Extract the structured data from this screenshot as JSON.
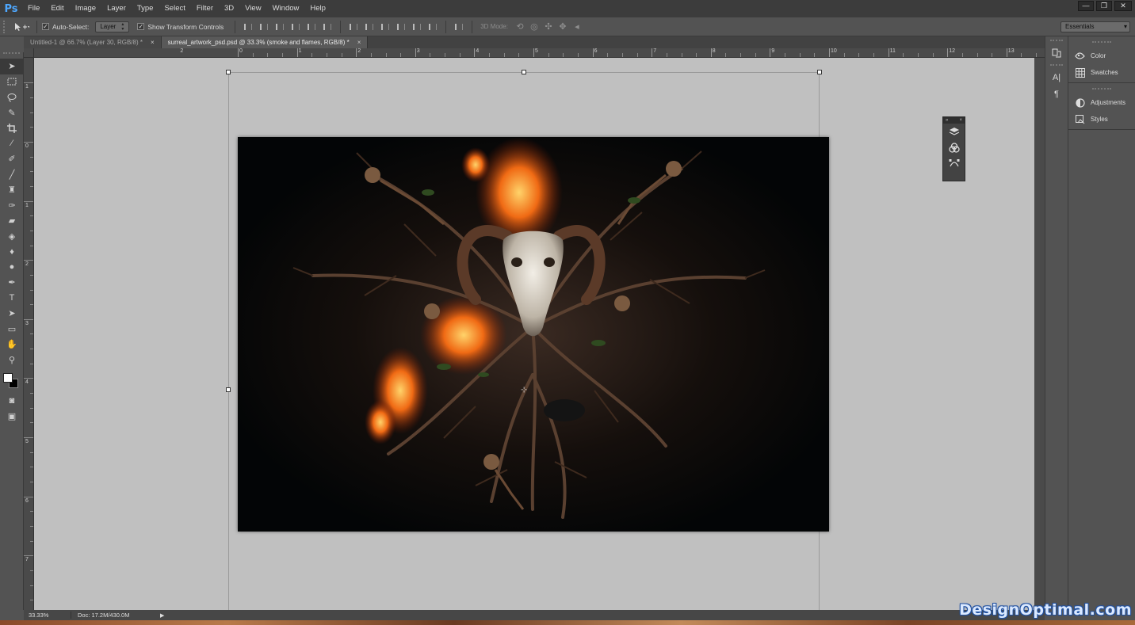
{
  "app": {
    "logo": "Ps"
  },
  "menu": [
    "File",
    "Edit",
    "Image",
    "Layer",
    "Type",
    "Select",
    "Filter",
    "3D",
    "View",
    "Window",
    "Help"
  ],
  "window_controls": {
    "minimize": "—",
    "restore": "❐",
    "close": "✕"
  },
  "options": {
    "auto_select_label": "Auto-Select:",
    "auto_select_checked": "✓",
    "auto_select_target": "Layer",
    "show_transform_label": "Show Transform Controls",
    "show_transform_checked": "✓",
    "mode_3d_label": "3D Mode:",
    "workspace": "Essentials"
  },
  "tabs": [
    {
      "label": "Untitled-1 @ 66.7% (Layer 30, RGB/8) *",
      "close": "×"
    },
    {
      "label": "surreal_artwork_psd.psd @ 33.3% (smoke and flames, RGB/8) *",
      "close": "×"
    }
  ],
  "ruler": {
    "h_labels": [
      "0",
      "1",
      "2",
      "3",
      "4",
      "5",
      "6",
      "7",
      "8",
      "9",
      "10",
      "11",
      "12",
      "13"
    ],
    "v_labels": [
      "1",
      "0",
      "1",
      "2",
      "3",
      "4",
      "5",
      "6",
      "7"
    ]
  },
  "panels": {
    "dock": [
      {
        "label": "Color",
        "icon": "color-wheel-icon"
      },
      {
        "label": "Swatches",
        "icon": "swatches-grid-icon"
      },
      {
        "label": "Adjustments",
        "icon": "adjustments-icon"
      },
      {
        "label": "Styles",
        "icon": "styles-icon"
      }
    ]
  },
  "status": {
    "zoom": "33.33%",
    "doc": "Doc: 17.2M/430.0M",
    "arrow": "▶"
  },
  "watermark": "DesignOptimal.com",
  "colors": {
    "foreground": "#ffffff",
    "background": "#000000",
    "accent": "#4ea8ff"
  }
}
